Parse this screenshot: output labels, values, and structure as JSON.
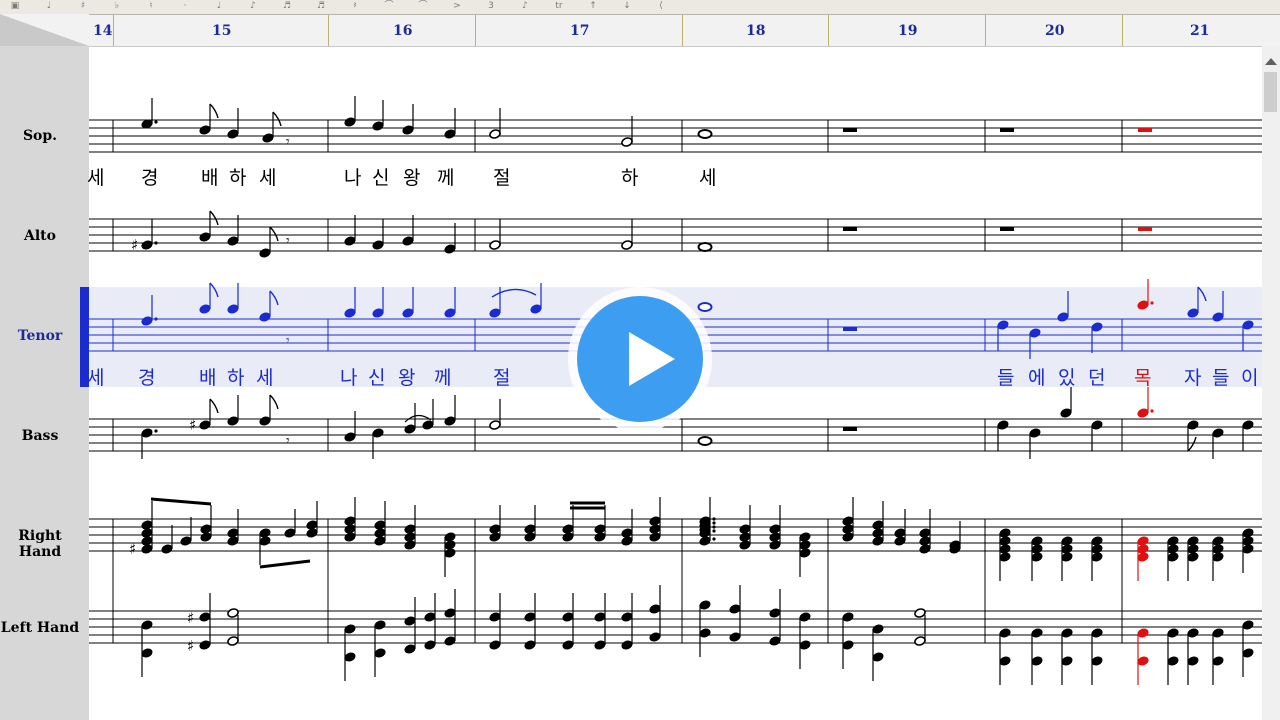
{
  "toolbar": {
    "icons": [
      "doc-icon",
      "note-icon",
      "sharp-icon",
      "flat-icon",
      "natural-icon",
      "dot-icon",
      "quarter-icon",
      "eighth-icon",
      "sixteenth-icon",
      "thirty-second-icon",
      "rest-icon",
      "tie-icon",
      "slur-icon",
      "accent-icon",
      "tuplet-icon",
      "grace-icon",
      "trill-icon",
      "up-arrow-icon",
      "down-arrow-icon",
      "hairpin-icon"
    ]
  },
  "measures": [
    "14",
    "15",
    "16",
    "17",
    "18",
    "19",
    "20",
    "21"
  ],
  "parts": {
    "soprano": "Sop.",
    "alto": "Alto",
    "tenor": "Tenor",
    "bass": "Bass",
    "right_hand": "Right Hand",
    "left_hand": "Left Hand"
  },
  "lyrics": {
    "soprano": [
      "세",
      "경",
      "배",
      "하",
      "세",
      "나",
      "신",
      "왕",
      "께",
      "절",
      "하",
      "세"
    ],
    "tenor": [
      "세",
      "경",
      "배",
      "하",
      "세",
      "나",
      "신",
      "왕",
      "께",
      "절",
      "들",
      "에",
      "있",
      "던",
      "목",
      "자",
      "들",
      "이"
    ]
  },
  "colors": {
    "staff": "#000000",
    "active_part": "#1a2bd0",
    "measure_numbers": "#1a2b9a",
    "highlight": "#e01010",
    "play_button": "#3d9df0"
  },
  "overlay": {
    "play_icon": "play-icon"
  }
}
